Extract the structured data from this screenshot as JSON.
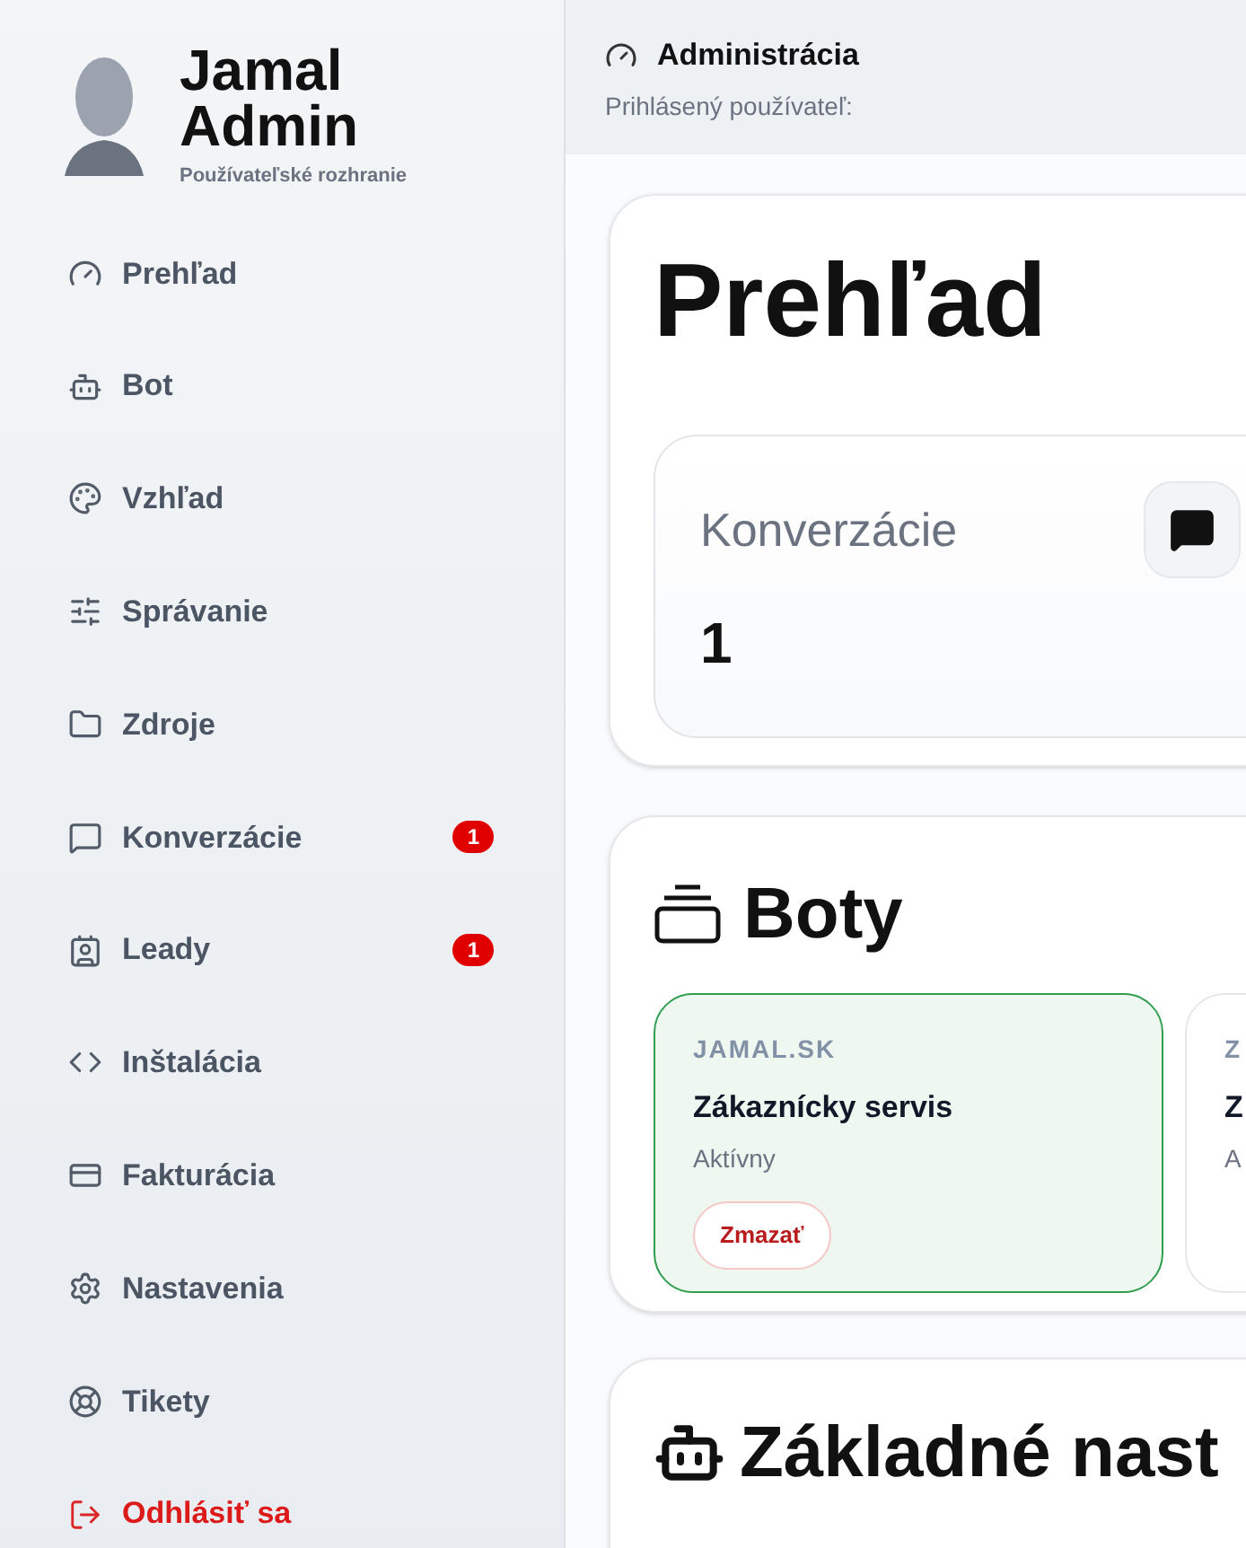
{
  "brand": {
    "name": "Jamal Admin",
    "subtitle": "Používateľské rozhranie"
  },
  "nav": [
    {
      "label": "Prehľad",
      "kind": "normal"
    },
    {
      "label": "Bot",
      "kind": "normal"
    },
    {
      "label": "Vzhľad",
      "kind": "normal"
    },
    {
      "label": "Správanie",
      "kind": "normal"
    },
    {
      "label": "Zdroje",
      "kind": "normal"
    },
    {
      "label": "Konverzácie",
      "kind": "normal",
      "badge": "1"
    },
    {
      "label": "Leady",
      "kind": "normal",
      "badge": "1"
    },
    {
      "label": "Inštalácia",
      "kind": "normal"
    },
    {
      "label": "Fakturácia",
      "kind": "normal"
    },
    {
      "label": "Nastavenia",
      "kind": "normal"
    },
    {
      "label": "Tikety",
      "kind": "normal"
    },
    {
      "label": "Odhlásiť sa",
      "kind": "danger"
    }
  ],
  "header": {
    "title": "Administrácia",
    "subtitle": "Prihlásený používateľ:"
  },
  "overview": {
    "title": "Prehľad",
    "stat": {
      "label": "Konverzácie",
      "value": "1"
    }
  },
  "bots_section": {
    "title": "Boty",
    "bots": [
      {
        "domain": "JAMAL.SK",
        "name": "Zákaznícky servis",
        "status": "Aktívny",
        "delete": "Zmazať",
        "selected": true
      },
      {
        "domain": "Z",
        "name": "Z",
        "status": "A",
        "selected": false
      }
    ]
  },
  "settings_section": {
    "title": "Základné nast"
  }
}
